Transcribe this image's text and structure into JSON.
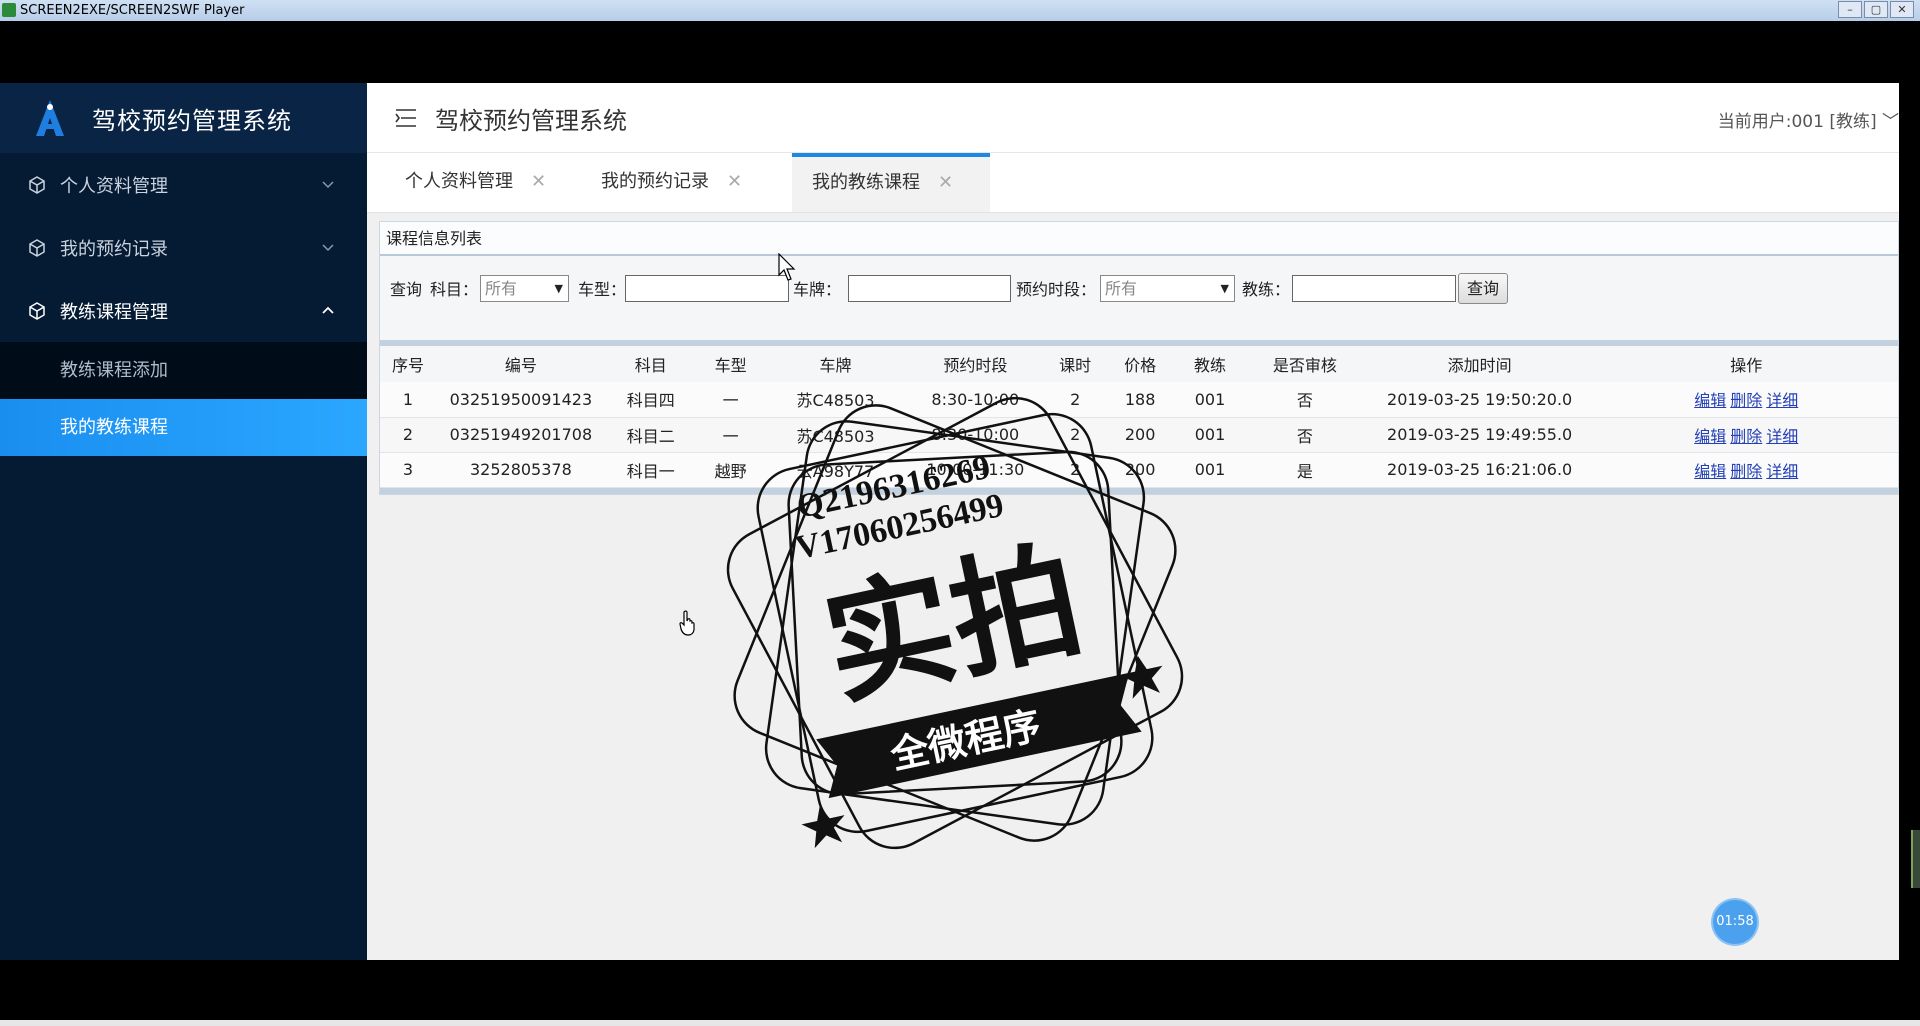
{
  "window": {
    "title": "SCREEN2EXE/SCREEN2SWF Player",
    "buttons": [
      "minimize",
      "maximize",
      "close"
    ]
  },
  "sidebar": {
    "title": "驾校预约管理系统",
    "items": [
      {
        "label": "个人资料管理",
        "icon": "cube-icon",
        "state": "collapsed"
      },
      {
        "label": "我的预约记录",
        "icon": "cube-icon",
        "state": "collapsed"
      },
      {
        "label": "教练课程管理",
        "icon": "cube-icon",
        "state": "expanded"
      }
    ],
    "subitems": [
      {
        "label": "教练课程添加",
        "active": false
      },
      {
        "label": "我的教练课程",
        "active": true
      }
    ]
  },
  "header": {
    "title": "驾校预约管理系统",
    "user": "当前用户:001 [教练]"
  },
  "tabs": [
    {
      "label": "个人资料管理",
      "close": "✕"
    },
    {
      "label": "我的预约记录",
      "close": "✕"
    },
    {
      "label": "我的教练课程",
      "close": "✕",
      "active": true
    }
  ],
  "panel": {
    "title": "课程信息列表"
  },
  "search": {
    "query_label": "查询",
    "subject_label": "科目：",
    "subject_value": "所有",
    "car_type_label": "车型：",
    "car_type_value": "",
    "plate_label": "车牌：",
    "plate_value": "",
    "period_label": "预约时段：",
    "period_value": "所有",
    "coach_label": "教练：",
    "coach_value": "",
    "button_label": "查询"
  },
  "table": {
    "headers": [
      "序号",
      "编号",
      "科目",
      "车型",
      "车牌",
      "预约时段",
      "课时",
      "价格",
      "教练",
      "是否审核",
      "添加时间",
      "操作"
    ],
    "rows": [
      {
        "seq": "1",
        "id": "03251950091423",
        "subject": "科目四",
        "car_type": "一",
        "plate": "苏C48503",
        "period": "8:30-10:00",
        "hours": "2",
        "price": "188",
        "coach": "001",
        "approved": "否",
        "added": "2019-03-25 19:50:20.0"
      },
      {
        "seq": "2",
        "id": "03251949201708",
        "subject": "科目二",
        "car_type": "一",
        "plate": "苏C48503",
        "period": "8:30-10:00",
        "hours": "2",
        "price": "200",
        "coach": "001",
        "approved": "否",
        "added": "2019-03-25 19:49:55.0"
      },
      {
        "seq": "3",
        "id": "3252805378",
        "subject": "科目一",
        "car_type": "越野",
        "plate": "云A98Y77",
        "period": "10:00-11:30",
        "hours": "2",
        "price": "200",
        "coach": "001",
        "approved": "是",
        "added": "2019-03-25 16:21:06.0"
      }
    ],
    "actions": [
      "编辑",
      "删除",
      "详细"
    ]
  },
  "timer": "01:58",
  "watermark": {
    "line1": "Q2196316269",
    "line2": "V17060256499",
    "main": "实拍",
    "ribbon": "全微程序"
  },
  "colors": {
    "sidebar_bg": "#051a33",
    "active_item": "#1a8ef0",
    "tab_accent": "#1e88e5",
    "link": "#2440b8"
  }
}
